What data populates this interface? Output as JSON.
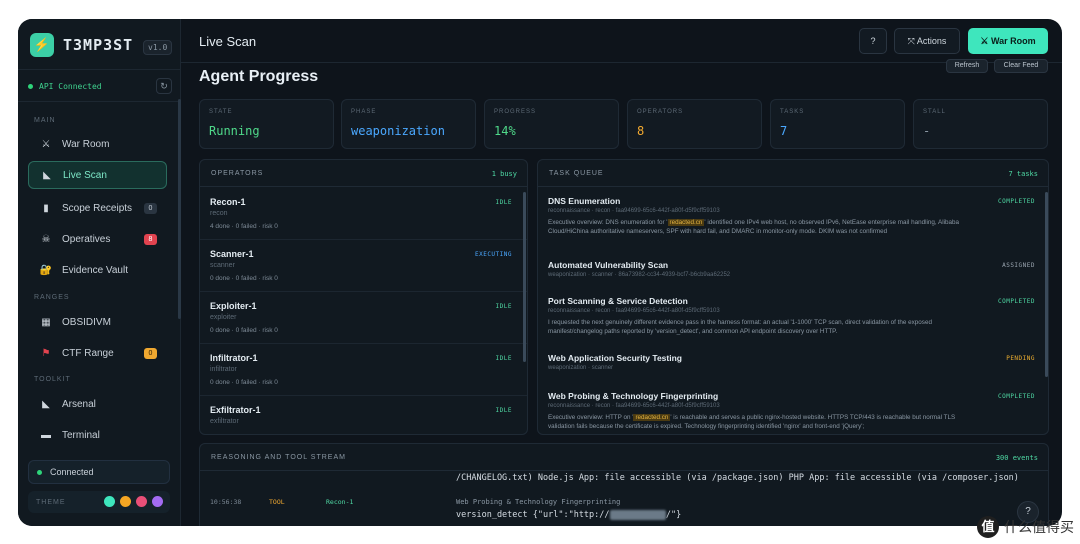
{
  "app": {
    "logo_glyph": "⚡",
    "name": "T3MP3ST",
    "version": "v1.0"
  },
  "sidebar": {
    "api_status": "API Connected",
    "sections": {
      "main": "MAIN",
      "ranges": "RANGES",
      "toolkit": "TOOLKIT"
    },
    "items": [
      {
        "label": "War Room",
        "icon": "⚔"
      },
      {
        "label": "Live Scan",
        "icon": "◣"
      },
      {
        "label": "Scope Receipts",
        "icon": "▮",
        "badge": "0"
      },
      {
        "label": "Operatives",
        "icon": "☠",
        "badge": "8"
      },
      {
        "label": "Evidence Vault",
        "icon": "🔐"
      },
      {
        "label": "OBSIDIVM",
        "icon": "▦"
      },
      {
        "label": "CTF Range",
        "icon": "⚑",
        "badge": "0"
      },
      {
        "label": "Arsenal",
        "icon": "◣"
      },
      {
        "label": "Terminal",
        "icon": "▬"
      }
    ],
    "connection": "Connected",
    "theme_label": "THEME",
    "theme_colors": [
      "#3ee6bd",
      "#f5a623",
      "#e94f78",
      "#a36bf2"
    ]
  },
  "topbar": {
    "title": "Live Scan",
    "help_label": "?",
    "actions_label": "⤧ Actions",
    "war_room_label": "⚔ War Room"
  },
  "main": {
    "title": "Agent Progress",
    "refresh_label": "Refresh",
    "clear_label": "Clear Feed",
    "stats": [
      {
        "label": "STATE",
        "value": "Running",
        "color": "#4fd98a"
      },
      {
        "label": "PHASE",
        "value": "weaponization",
        "color": "#4aa8ff"
      },
      {
        "label": "PROGRESS",
        "value": "14%",
        "color": "#4fd98a"
      },
      {
        "label": "OPERATORS",
        "value": "8",
        "color": "#f0a830"
      },
      {
        "label": "TASKS",
        "value": "7",
        "color": "#4aa8ff"
      },
      {
        "label": "STALL",
        "value": "-",
        "color": "#8a97a3"
      }
    ]
  },
  "operators": {
    "title": "OPERATORS",
    "count": "1 busy",
    "items": [
      {
        "name": "Recon-1",
        "role": "recon",
        "stats": "4 done · 0 failed · risk 0",
        "status": "IDLE"
      },
      {
        "name": "Scanner-1",
        "role": "scanner",
        "stats": "0 done · 0 failed · risk 0",
        "status": "EXECUTING"
      },
      {
        "name": "Exploiter-1",
        "role": "exploiter",
        "stats": "0 done · 0 failed · risk 0",
        "status": "IDLE"
      },
      {
        "name": "Infiltrator-1",
        "role": "infiltrator",
        "stats": "0 done · 0 failed · risk 0",
        "status": "IDLE"
      },
      {
        "name": "Exfiltrator-1",
        "role": "exfiltrator",
        "stats": "",
        "status": "IDLE"
      }
    ]
  },
  "tasks": {
    "title": "TASK QUEUE",
    "count": "7 tasks",
    "items": [
      {
        "name": "DNS Enumeration",
        "meta": "reconnaissance · recon · faa94699-65c6-442f-a80f-d5f9cff59103",
        "desc_a": "Executive overview: DNS enumeration for '",
        "desc_b": "' identified one IPv4 web host, no observed IPv6, NetEase enterprise mail handling, Alibaba Cloud/HiChina authoritative nameservers, SPF with hard fail, and DMARC in monitor-only mode. DKIM was not confirmed",
        "status": "COMPLETED"
      },
      {
        "name": "Automated Vulnerability Scan",
        "meta": "weaponization · scanner · 86a73982-cc34-4939-bcf7-b6cb9aa62252",
        "desc_a": "",
        "desc_b": "",
        "status": "ASSIGNED"
      },
      {
        "name": "Port Scanning & Service Detection",
        "meta": "reconnaissance · recon · faa94699-65c6-442f-a80f-d5f9cff59103",
        "desc_a": "",
        "desc_b": "I requested the next genuinely different evidence pass in the harness format: an actual '1-1000' TCP scan, direct validation of the exposed manifest/changelog paths reported by 'version_detect', and common API endpoint discovery over HTTP.",
        "status": "COMPLETED"
      },
      {
        "name": "Web Application Security Testing",
        "meta": "weaponization · scanner",
        "desc_a": "",
        "desc_b": "",
        "status": "PENDING"
      },
      {
        "name": "Web Probing & Technology Fingerprinting",
        "meta": "reconnaissance · recon · faa94699-65c6-442f-a80f-d5f9cff59103",
        "desc_a": "Executive overview: HTTP on '",
        "desc_b": "' is reachable and serves a public nginx-hosted website. HTTPS TCP/443 is reachable but normal TLS validation fails because the certificate is expired. Technology fingerprinting identified 'nginx' and front-end 'jQuery';",
        "status": "COMPLETED"
      }
    ]
  },
  "stream": {
    "title": "REASONING AND TOOL STREAM",
    "count": "300 events",
    "line1": "/CHANGELOG.txt) Node.js App: file accessible (via /package.json) PHP App: file accessible (via /composer.json)",
    "time": "10:56:38",
    "kind": "TOOL",
    "agent": "Recon-1",
    "label": "Web Probing & Technology Fingerprinting",
    "cmd_a": "version_detect {\"url\":\"http://",
    "cmd_b": "/\"}",
    "help_label": "?"
  },
  "watermark": {
    "glyph": "值",
    "text": "什么值得买"
  },
  "colors": {
    "accent": "#3ee6bd",
    "idle": "#4fd9a4",
    "executing": "#4aa8ff",
    "completed": "#4fd9a4",
    "assigned": "#9aa5b0",
    "pending": "#f0b030"
  }
}
